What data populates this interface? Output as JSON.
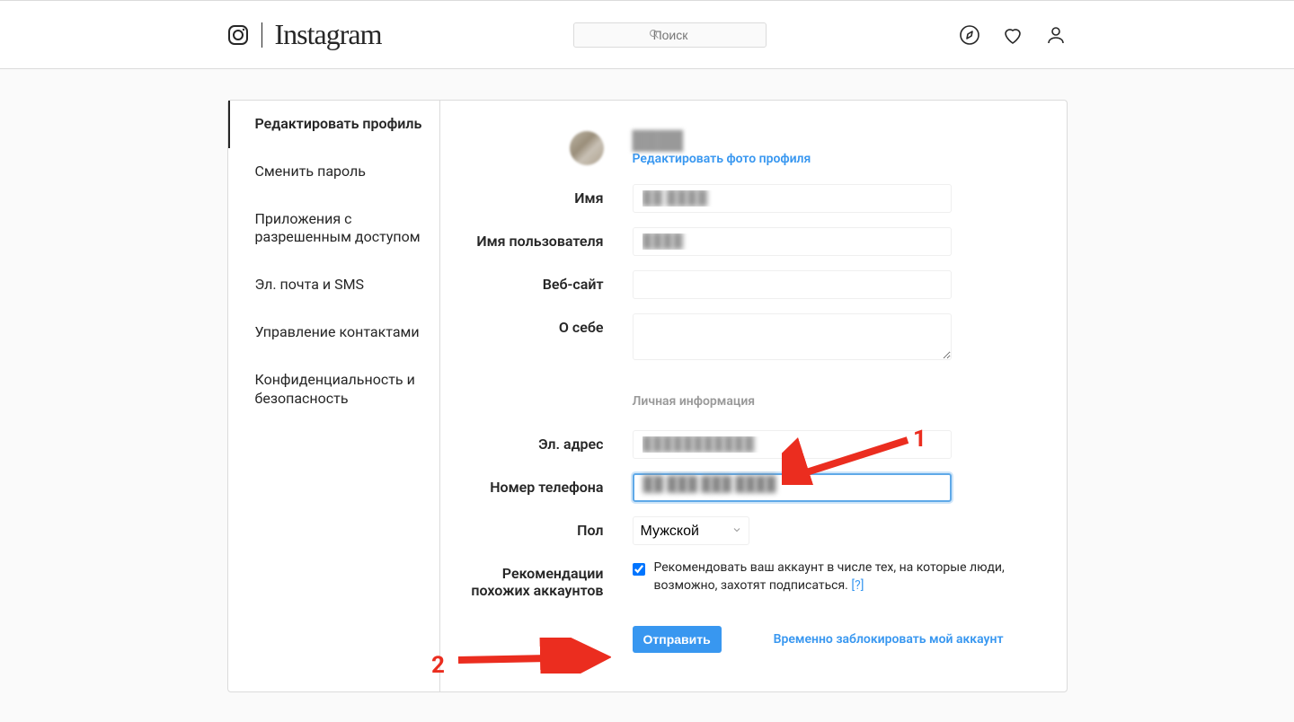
{
  "brand": {
    "name": "Instagram"
  },
  "search": {
    "placeholder": "Поиск"
  },
  "sidebar": {
    "items": [
      {
        "label": "Редактировать профиль"
      },
      {
        "label": "Сменить пароль"
      },
      {
        "label": "Приложения с разрешенным доступом"
      },
      {
        "label": "Эл. почта и SMS"
      },
      {
        "label": "Управление контактами"
      },
      {
        "label": "Конфиденциальность и безопасность"
      }
    ]
  },
  "profile": {
    "change_photo": "Редактировать фото профиля",
    "username_blur": "████"
  },
  "labels": {
    "name": "Имя",
    "username": "Имя пользователя",
    "website": "Веб-сайт",
    "bio": "О себе",
    "section": "Личная информация",
    "email": "Эл. адрес",
    "phone": "Номер телефона",
    "gender": "Пол",
    "recommend": "Рекомендации похожих аккаунтов"
  },
  "fields": {
    "name_blur": "██ ████",
    "username_blur": "████",
    "email_blur": "███████████",
    "phone_blur": "██ ███ ███ ████",
    "gender_selected": "Мужской"
  },
  "recommend": {
    "text": "Рекомендовать ваш аккаунт в числе тех, на которые люди, возможно, захотят подписаться.",
    "help": "[?]"
  },
  "actions": {
    "submit": "Отправить",
    "disable": "Временно заблокировать мой аккаунт"
  },
  "annotations": {
    "one": "1",
    "two": "2"
  }
}
